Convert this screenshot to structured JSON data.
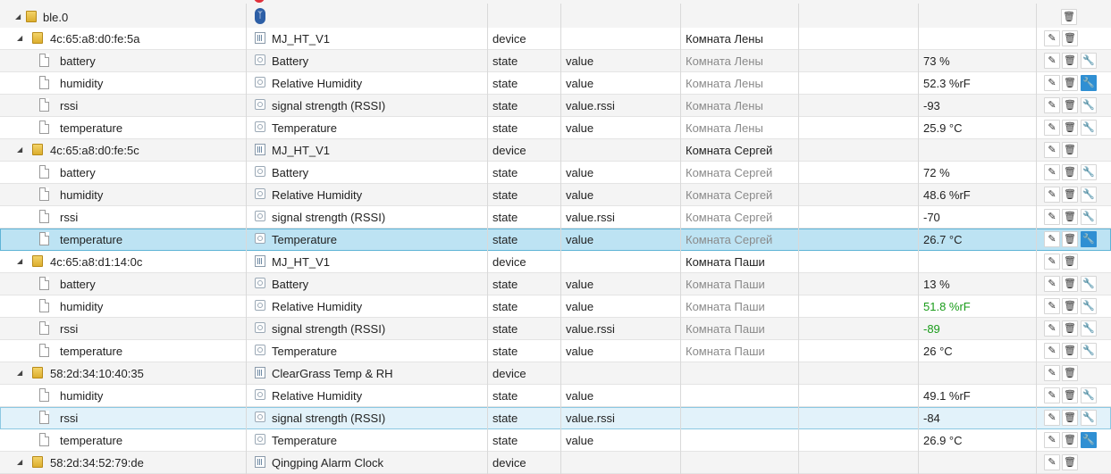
{
  "tree": {
    "root": {
      "name": "ble.0"
    },
    "rows": [
      {
        "kind": "device",
        "id": "4c:65:a8:d0:fe:5a",
        "name": "MJ_HT_V1",
        "type": "device",
        "role": "",
        "room": "Комната Лены",
        "value": "",
        "room_muted": false,
        "value_color": "",
        "buttons": [
          "edit",
          "delete"
        ]
      },
      {
        "kind": "state",
        "id": "battery",
        "name": "Battery",
        "type": "state",
        "role": "value",
        "room": "Комната Лены",
        "value": "73 %",
        "room_muted": true,
        "value_color": "",
        "buttons": [
          "edit",
          "delete",
          "tool"
        ]
      },
      {
        "kind": "state",
        "id": "humidity",
        "name": "Relative Humidity",
        "type": "state",
        "role": "value",
        "room": "Комната Лены",
        "value": "52.3 %rF",
        "room_muted": true,
        "value_color": "",
        "buttons": [
          "edit",
          "delete",
          "tool-active"
        ]
      },
      {
        "kind": "state",
        "id": "rssi",
        "name": "signal strength (RSSI)",
        "type": "state",
        "role": "value.rssi",
        "room": "Комната Лены",
        "value": "-93",
        "room_muted": true,
        "value_color": "",
        "buttons": [
          "edit",
          "delete",
          "tool"
        ]
      },
      {
        "kind": "state",
        "id": "temperature",
        "name": "Temperature",
        "type": "state",
        "role": "value",
        "room": "Комната Лены",
        "value": "25.9 °C",
        "room_muted": true,
        "value_color": "",
        "buttons": [
          "edit",
          "delete",
          "tool"
        ]
      },
      {
        "kind": "device",
        "id": "4c:65:a8:d0:fe:5c",
        "name": "MJ_HT_V1",
        "type": "device",
        "role": "",
        "room": "Комната Сергей",
        "value": "",
        "room_muted": false,
        "value_color": "",
        "buttons": [
          "edit",
          "delete"
        ]
      },
      {
        "kind": "state",
        "id": "battery",
        "name": "Battery",
        "type": "state",
        "role": "value",
        "room": "Комната Сергей",
        "value": "72 %",
        "room_muted": true,
        "value_color": "",
        "buttons": [
          "edit",
          "delete",
          "tool"
        ]
      },
      {
        "kind": "state",
        "id": "humidity",
        "name": "Relative Humidity",
        "type": "state",
        "role": "value",
        "room": "Комната Сергей",
        "value": "48.6 %rF",
        "room_muted": true,
        "value_color": "",
        "buttons": [
          "edit",
          "delete",
          "tool"
        ]
      },
      {
        "kind": "state",
        "id": "rssi",
        "name": "signal strength (RSSI)",
        "type": "state",
        "role": "value.rssi",
        "room": "Комната Сергей",
        "value": "-70",
        "room_muted": true,
        "value_color": "",
        "buttons": [
          "edit",
          "delete",
          "tool"
        ]
      },
      {
        "kind": "state",
        "id": "temperature",
        "name": "Temperature",
        "type": "state",
        "role": "value",
        "room": "Комната Сергей",
        "value": "26.7 °C",
        "room_muted": true,
        "value_color": "",
        "selected": "strong",
        "buttons": [
          "edit",
          "delete",
          "tool-active"
        ]
      },
      {
        "kind": "device",
        "id": "4c:65:a8:d1:14:0c",
        "name": "MJ_HT_V1",
        "type": "device",
        "role": "",
        "room": "Комната Паши",
        "value": "",
        "room_muted": false,
        "value_color": "",
        "buttons": [
          "edit",
          "delete"
        ]
      },
      {
        "kind": "state",
        "id": "battery",
        "name": "Battery",
        "type": "state",
        "role": "value",
        "room": "Комната Паши",
        "value": "13 %",
        "room_muted": true,
        "value_color": "",
        "buttons": [
          "edit",
          "delete",
          "tool"
        ]
      },
      {
        "kind": "state",
        "id": "humidity",
        "name": "Relative Humidity",
        "type": "state",
        "role": "value",
        "room": "Комната Паши",
        "value": "51.8 %rF",
        "room_muted": true,
        "value_color": "green",
        "buttons": [
          "edit",
          "delete",
          "tool"
        ]
      },
      {
        "kind": "state",
        "id": "rssi",
        "name": "signal strength (RSSI)",
        "type": "state",
        "role": "value.rssi",
        "room": "Комната Паши",
        "value": "-89",
        "room_muted": true,
        "value_color": "green",
        "buttons": [
          "edit",
          "delete",
          "tool"
        ]
      },
      {
        "kind": "state",
        "id": "temperature",
        "name": "Temperature",
        "type": "state",
        "role": "value",
        "room": "Комната Паши",
        "value": "26 °C",
        "room_muted": true,
        "value_color": "",
        "buttons": [
          "edit",
          "delete",
          "tool"
        ]
      },
      {
        "kind": "device",
        "id": "58:2d:34:10:40:35",
        "name": "ClearGrass Temp & RH",
        "type": "device",
        "role": "",
        "room": "",
        "value": "",
        "room_muted": false,
        "value_color": "",
        "buttons": [
          "edit",
          "delete"
        ]
      },
      {
        "kind": "state",
        "id": "humidity",
        "name": "Relative Humidity",
        "type": "state",
        "role": "value",
        "room": "",
        "value": "49.1 %rF",
        "room_muted": true,
        "value_color": "",
        "buttons": [
          "edit",
          "delete",
          "tool"
        ]
      },
      {
        "kind": "state",
        "id": "rssi",
        "name": "signal strength (RSSI)",
        "type": "state",
        "role": "value.rssi",
        "room": "",
        "value": "-84",
        "room_muted": true,
        "value_color": "",
        "selected": "light",
        "buttons": [
          "edit",
          "delete",
          "tool"
        ]
      },
      {
        "kind": "state",
        "id": "temperature",
        "name": "Temperature",
        "type": "state",
        "role": "value",
        "room": "",
        "value": "26.9 °C",
        "room_muted": true,
        "value_color": "",
        "buttons": [
          "edit",
          "delete",
          "tool-active"
        ]
      },
      {
        "kind": "device",
        "id": "58:2d:34:52:79:de",
        "name": "Qingping Alarm Clock",
        "type": "device",
        "role": "",
        "room": "",
        "value": "",
        "room_muted": false,
        "value_color": "",
        "buttons": [
          "edit",
          "delete"
        ]
      }
    ]
  },
  "icons": {
    "expand": "triangle-icon",
    "folder": "folder-icon",
    "file": "file-icon",
    "bluetooth": "bluetooth-icon",
    "device": "device-icon",
    "state": "state-icon",
    "edit": "pencil-icon",
    "delete": "trash-icon",
    "tool": "wrench-icon"
  },
  "colors": {
    "selected_row": "#bde3f3",
    "selected_row_light": "#e2f2fa",
    "active_button": "#2f8fd3",
    "green_value": "#1a9c1a",
    "muted_text": "#8a8a8a"
  }
}
